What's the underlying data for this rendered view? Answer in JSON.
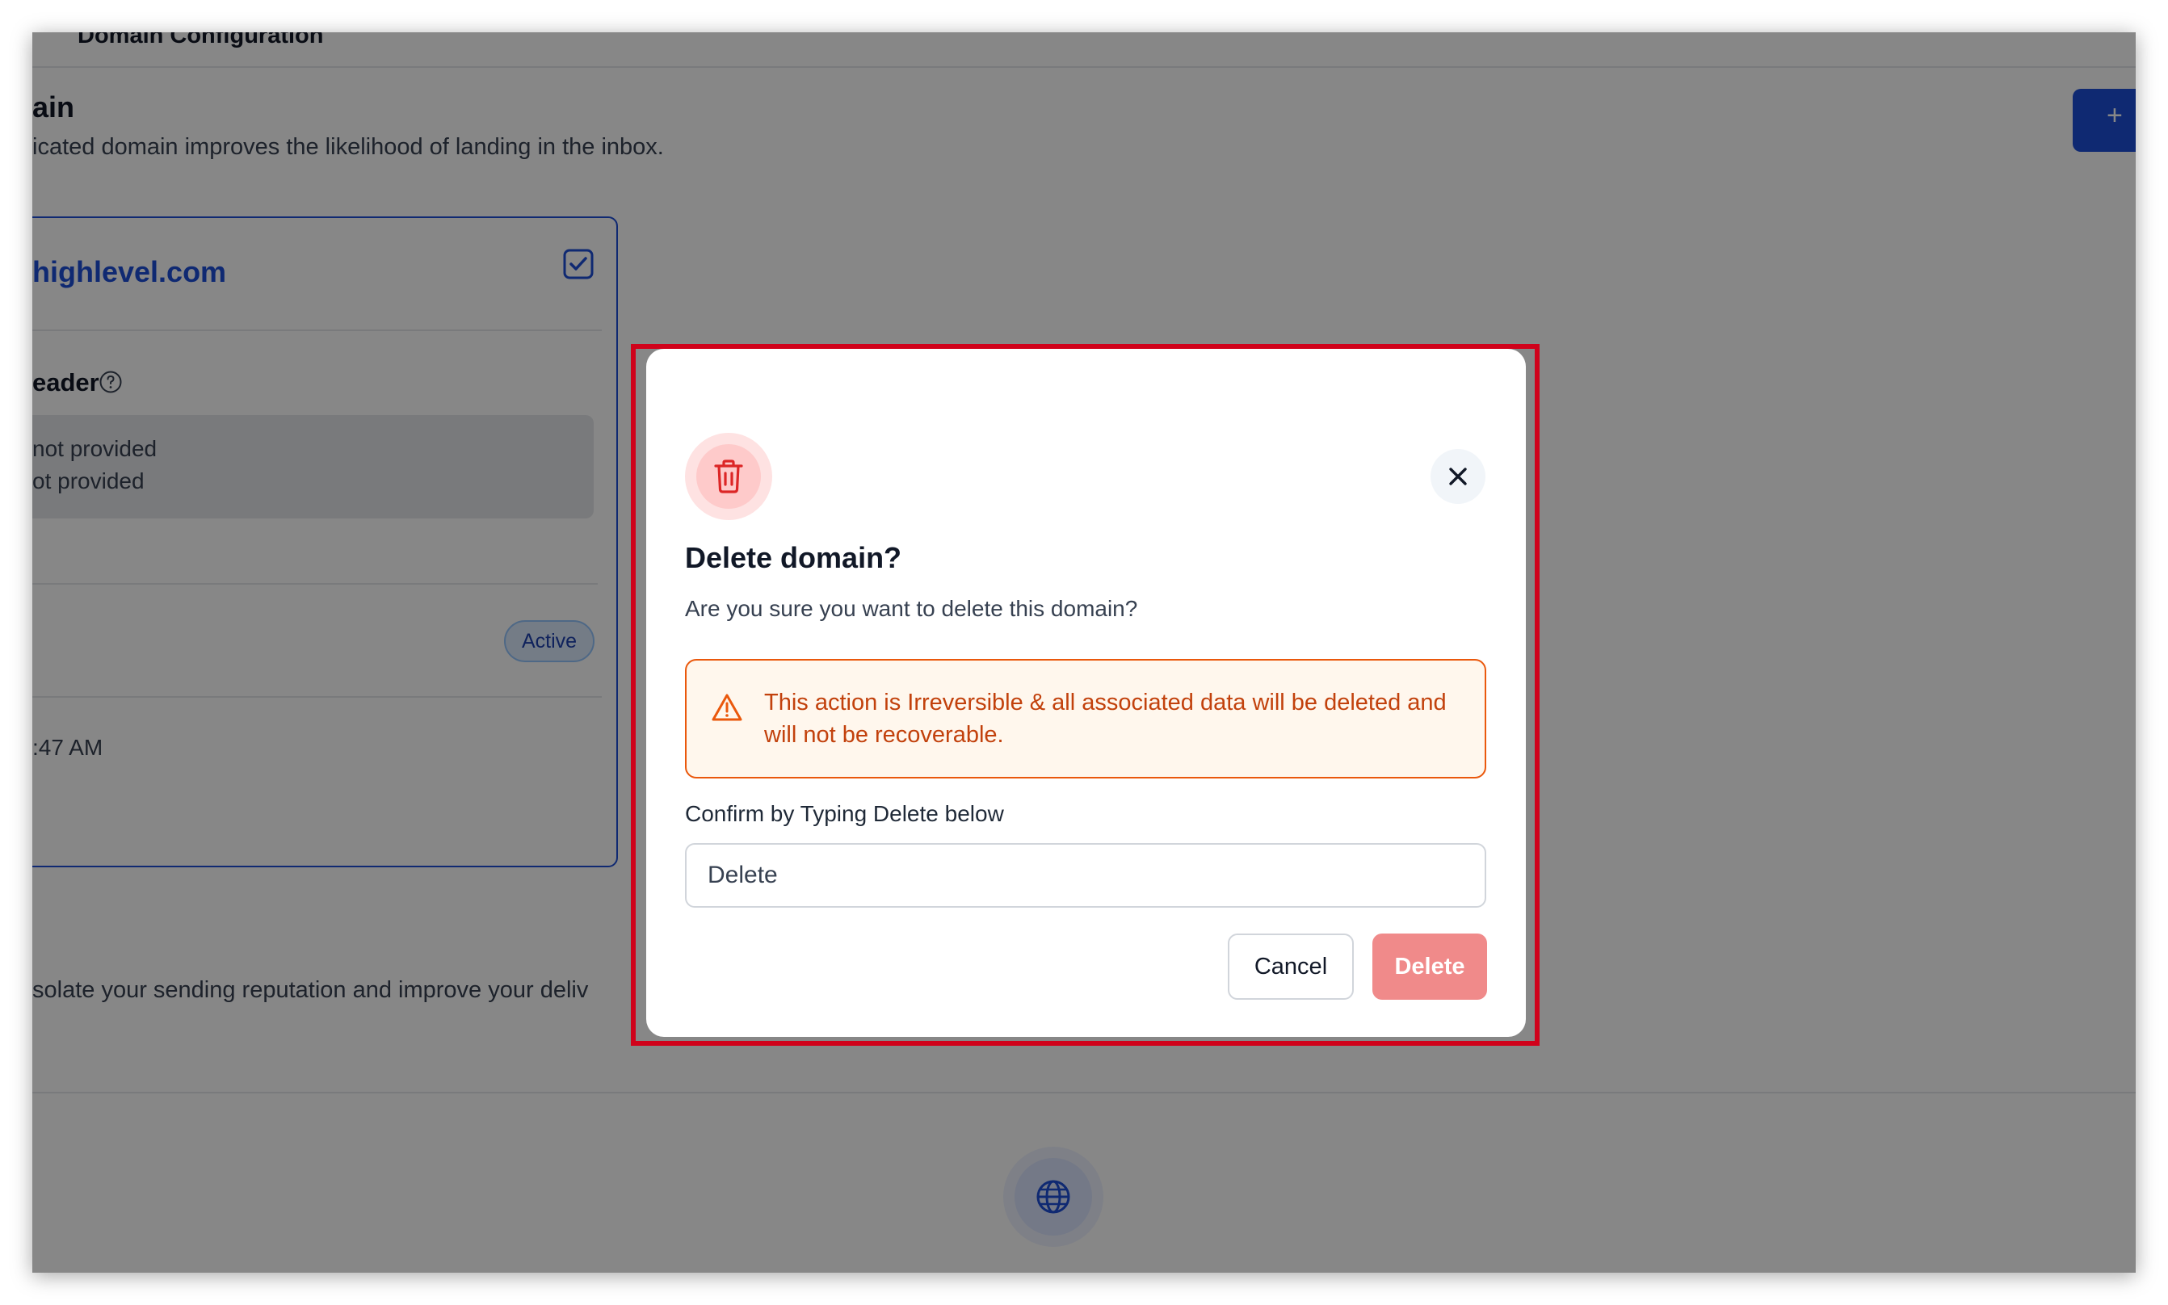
{
  "background": {
    "top_tab_label": "Domain Configuration",
    "section_title": "ain",
    "section_subtitle": "icated domain improves the likelihood of landing in the inbox.",
    "add_button_label": "+",
    "domain_name": "highlevel.com",
    "header_label": "eader",
    "grey_line1": "not provided",
    "grey_line2": "ot provided",
    "status_badge": "Active",
    "time_text": ":47 AM",
    "isolate_text": "solate your sending reputation and improve your deliv"
  },
  "modal": {
    "title": "Delete domain?",
    "message": "Are you sure you want to delete this domain?",
    "warning": "This action is Irreversible & all associated data will be deleted and will not be recoverable.",
    "confirm_label": "Confirm by Typing Delete below",
    "input_value": "Delete",
    "cancel_label": "Cancel",
    "delete_label": "Delete",
    "icons": {
      "header": "trash-icon",
      "close": "close-icon",
      "warning": "warning-triangle-icon"
    }
  },
  "colors": {
    "accent": "#1d4ed8",
    "danger": "#ef4444",
    "danger_disabled": "#f08a8a",
    "warning": "#ea580c",
    "highlight": "#d0021b"
  }
}
